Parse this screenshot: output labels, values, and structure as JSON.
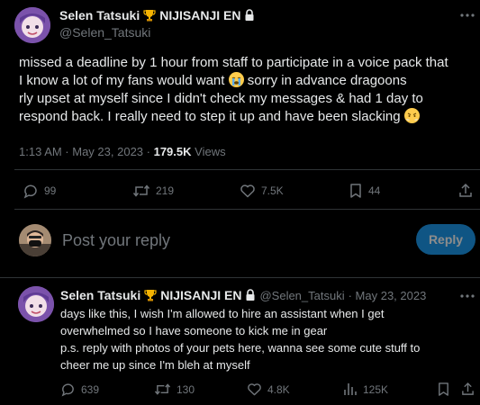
{
  "tweet": {
    "author": {
      "display_name": "Selen Tatsuki",
      "badge_text": "NIJISANJI EN",
      "handle": "@Selen_Tatsuki",
      "icons": [
        "trophy-icon",
        "lock-icon"
      ]
    },
    "text_lines": [
      "missed a deadline by 1 hour from staff to participate in a voice pack that",
      "I know a lot of my fans would want",
      "sorry in advance dragoons",
      "rly upset at myself since I didn't check my messages & had 1 day to",
      "respond back. I really need to step it up and have been slacking"
    ],
    "timestamp": "1:13 AM · May 23, 2023 ·",
    "views_count": "179.5K",
    "views_label": "Views",
    "actions": {
      "replies": "99",
      "retweets": "219",
      "likes": "7.5K",
      "bookmarks": "44"
    }
  },
  "compose": {
    "placeholder": "Post your reply",
    "button_label": "Reply"
  },
  "reply": {
    "author": {
      "display_name": "Selen Tatsuki",
      "badge_text": "NIJISANJI EN",
      "handle": "@Selen_Tatsuki",
      "date": "· May 23, 2023"
    },
    "text_lines": [
      "days like this, I wish I'm allowed to hire an assistant when I get",
      "overwhelmed so I have someone to kick me in gear",
      "p.s. reply with photos of your pets here, wanna see some cute stuff to",
      "cheer me up since I'm bleh at myself"
    ],
    "actions": {
      "replies": "639",
      "retweets": "130",
      "likes": "4.8K",
      "views": "125K"
    }
  },
  "colors": {
    "background": "#000000",
    "text": "#e7e9ea",
    "muted": "#71767b",
    "accent": "#1d9bf0",
    "divider": "#2f3336",
    "trophy": "#f5b301"
  }
}
